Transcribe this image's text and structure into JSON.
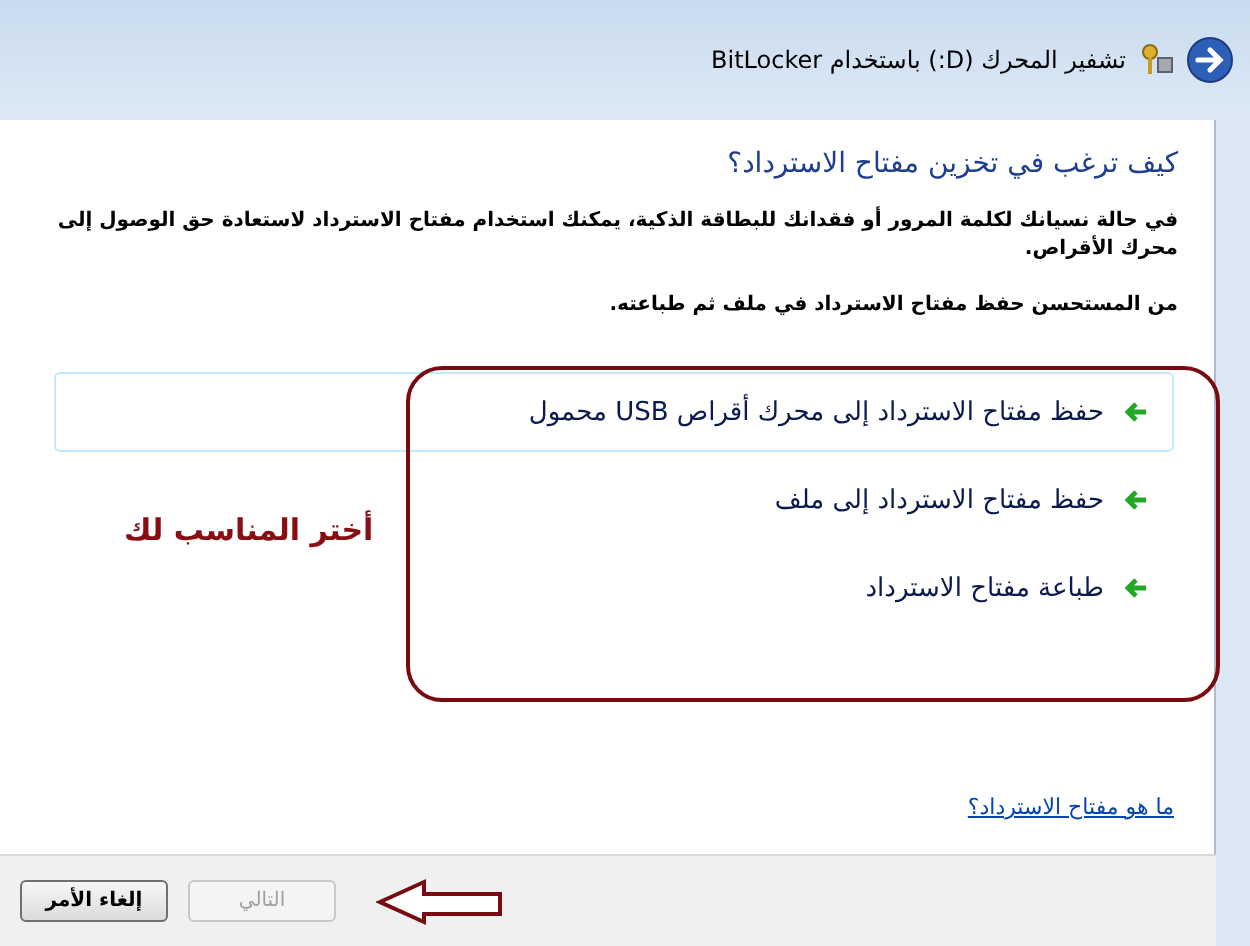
{
  "window": {
    "title": "تشفير المحرك (D:) باستخدام BitLocker"
  },
  "heading": "كيف ترغب في تخزين مفتاح الاسترداد؟",
  "paragraphs": [
    "في حالة نسيانك لكلمة المرور أو فقدانك للبطاقة الذكية، يمكنك استخدام مفتاح الاسترداد لاستعادة حق الوصول إلى محرك الأقراص.",
    "من المستحسن حفظ مفتاح الاسترداد في ملف ثم طباعته."
  ],
  "options": [
    {
      "label": "حفظ مفتاح الاسترداد إلى محرك أقراص USB محمول",
      "highlighted": true
    },
    {
      "label": "حفظ مفتاح الاسترداد إلى ملف",
      "highlighted": false
    },
    {
      "label": "طباعة مفتاح الاسترداد",
      "highlighted": false
    }
  ],
  "annotation": {
    "text": "أختر المناسب لك"
  },
  "help_link": "ما هو مفتاح الاسترداد؟",
  "buttons": [
    {
      "label": "التالي",
      "disabled": true
    },
    {
      "label": "إلغاء الأمر",
      "disabled": false
    }
  ]
}
